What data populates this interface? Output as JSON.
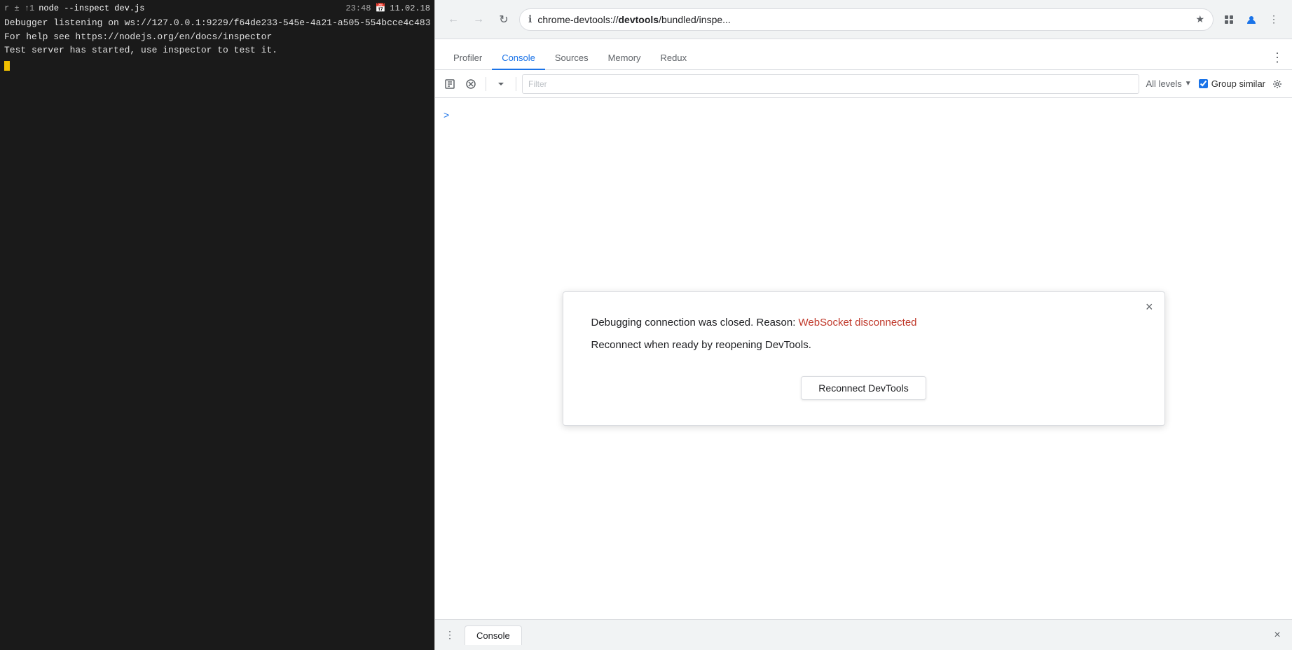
{
  "terminal": {
    "titlebar": {
      "prompt": "r ± ↑1",
      "command": "node --inspect dev.js",
      "time": "23:48",
      "calendar_icon": "📅",
      "date": "11.02.18"
    },
    "lines": [
      "Debugger listening on ws://127.0.0.1:9229/f64de233-545e-4a21-a505-554bcce4c483",
      "",
      "For help see https://nodejs.org/en/docs/inspector",
      "Test server has started, use inspector to test it."
    ]
  },
  "browser": {
    "url": {
      "prefix": "chrome-devtools://",
      "bold_part": "devtools",
      "suffix": "/bundled/inspe..."
    },
    "full_url": "chrome-devtools://devtools/bundled/inspe..."
  },
  "devtools": {
    "tabs": [
      {
        "label": "Profiler",
        "active": false
      },
      {
        "label": "Console",
        "active": true
      },
      {
        "label": "Sources",
        "active": false
      },
      {
        "label": "Memory",
        "active": false
      },
      {
        "label": "Redux",
        "active": false
      }
    ],
    "toolbar": {
      "filter_placeholder": "Filter",
      "levels_label": "All levels",
      "group_similar_label": "Group similar",
      "group_similar_checked": true
    },
    "console_prompt_symbol": ">",
    "dialog": {
      "title": "Debugging connection was closed.",
      "reason_prefix": "Debugging connection was closed. Reason: ",
      "reason_link": "WebSocket disconnected",
      "submessage": "Reconnect when ready by reopening DevTools.",
      "reconnect_button": "Reconnect DevTools",
      "close_symbol": "×"
    },
    "bottom_bar": {
      "tab_label": "Console",
      "close_symbol": "×",
      "menu_dots": "⋮"
    }
  }
}
